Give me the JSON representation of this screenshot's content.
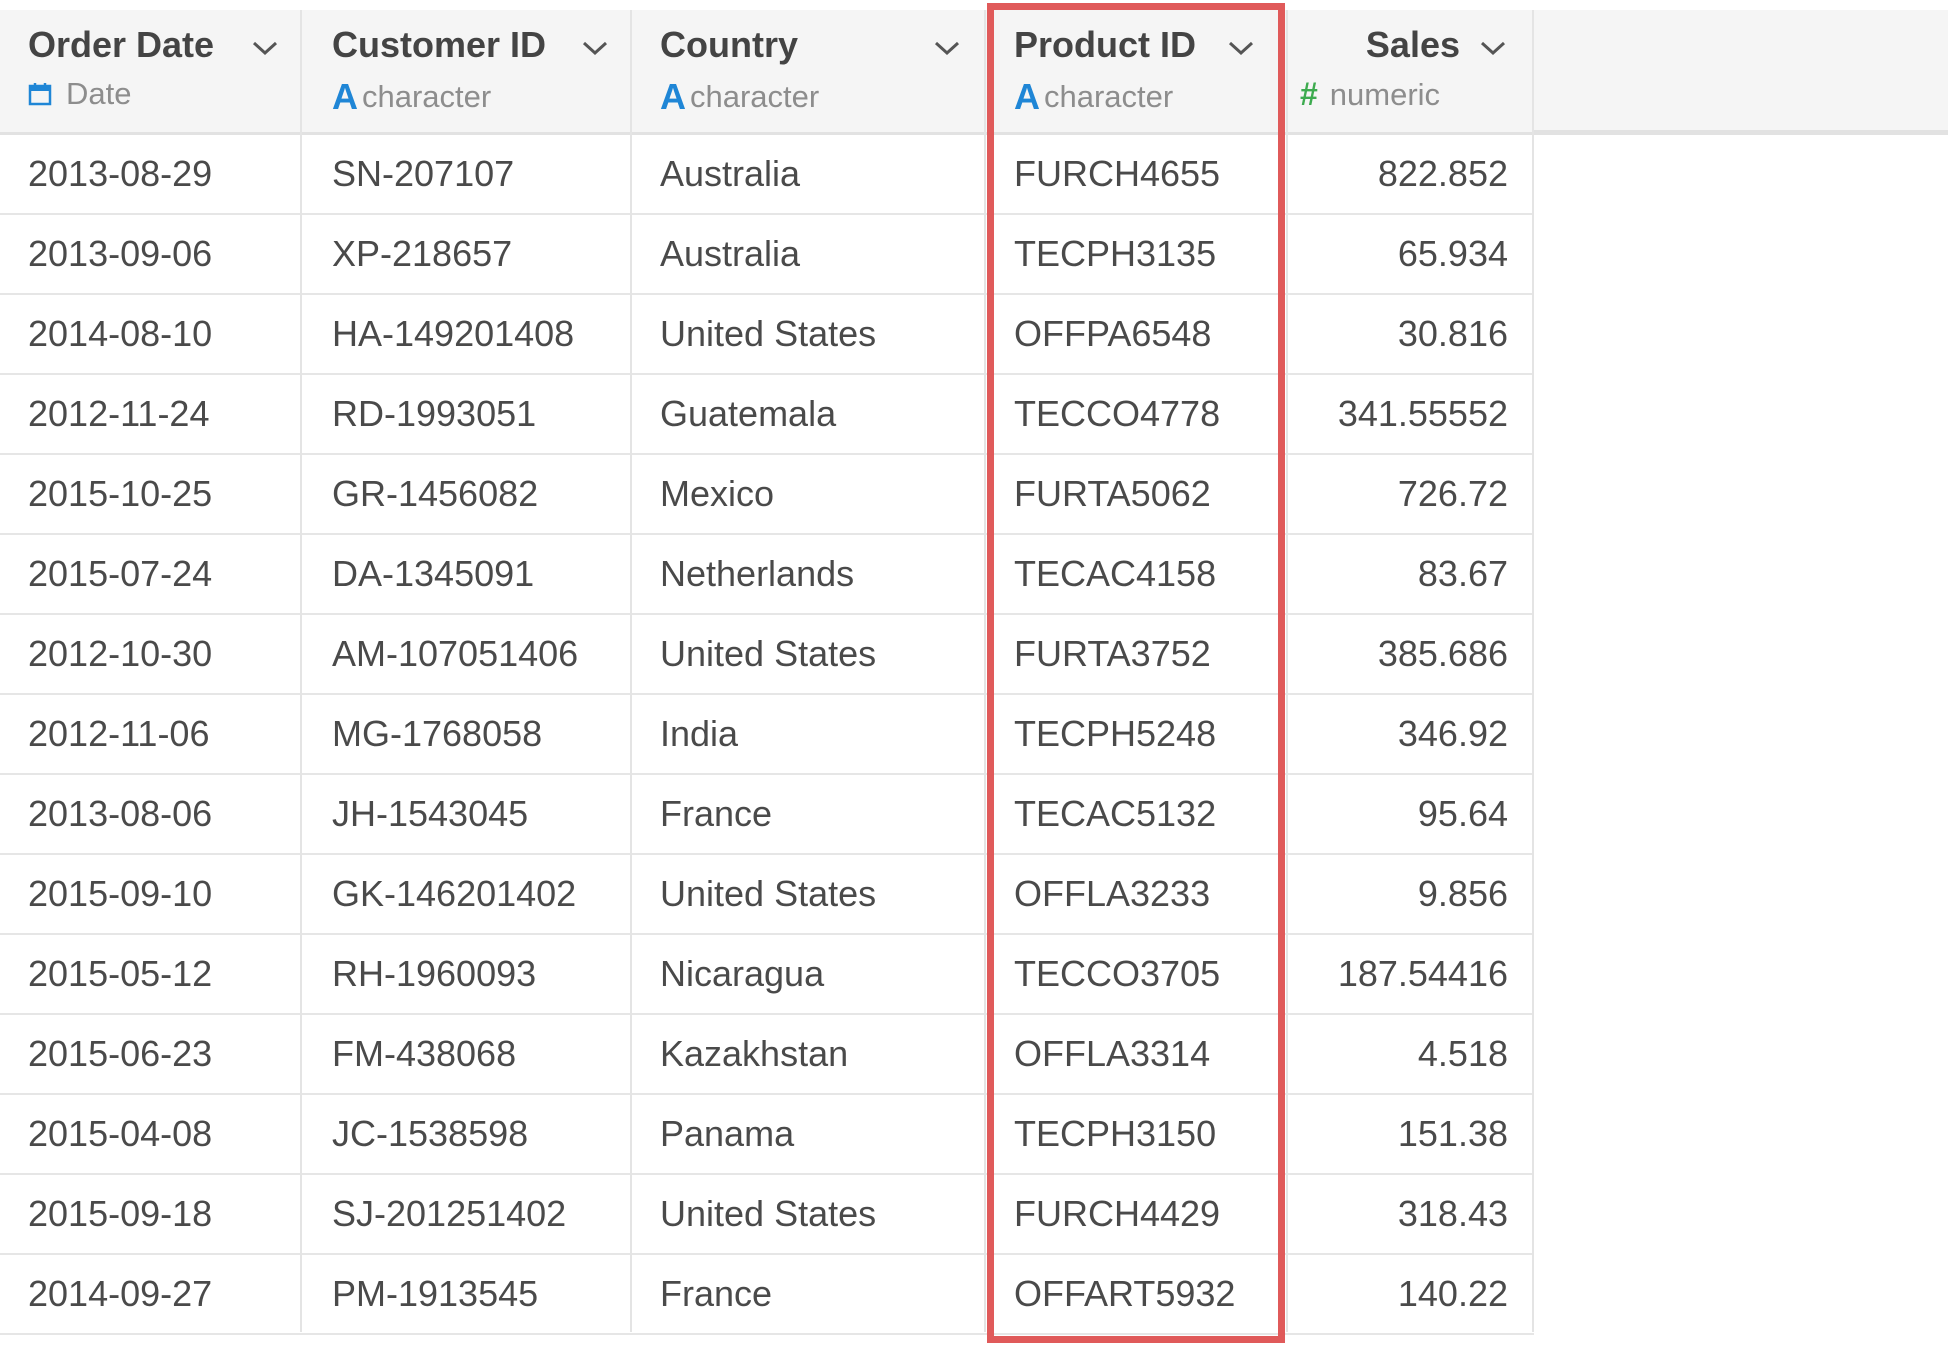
{
  "columns": [
    {
      "name": "Order Date",
      "type": "Date",
      "type_icon": "calendar-icon",
      "align": "left"
    },
    {
      "name": "Customer ID",
      "type": "character",
      "type_icon": "character-A-icon",
      "align": "left"
    },
    {
      "name": "Country",
      "type": "character",
      "type_icon": "character-A-icon",
      "align": "left"
    },
    {
      "name": "Product ID",
      "type": "character",
      "type_icon": "character-A-icon",
      "align": "left",
      "highlighted": true
    },
    {
      "name": "Sales",
      "type": "numeric",
      "type_icon": "numeric-hash-icon",
      "align": "right"
    }
  ],
  "rows": [
    [
      "2013-08-29",
      "SN-207107",
      "Australia",
      "FURCH4655",
      "822.852"
    ],
    [
      "2013-09-06",
      "XP-218657",
      "Australia",
      "TECPH3135",
      "65.934"
    ],
    [
      "2014-08-10",
      "HA-149201408",
      "United States",
      "OFFPA6548",
      "30.816"
    ],
    [
      "2012-11-24",
      "RD-1993051",
      "Guatemala",
      "TECCO4778",
      "341.55552"
    ],
    [
      "2015-10-25",
      "GR-1456082",
      "Mexico",
      "FURTA5062",
      "726.72"
    ],
    [
      "2015-07-24",
      "DA-1345091",
      "Netherlands",
      "TECAC4158",
      "83.67"
    ],
    [
      "2012-10-30",
      "AM-107051406",
      "United States",
      "FURTA3752",
      "385.686"
    ],
    [
      "2012-11-06",
      "MG-1768058",
      "India",
      "TECPH5248",
      "346.92"
    ],
    [
      "2013-08-06",
      "JH-1543045",
      "France",
      "TECAC5132",
      "95.64"
    ],
    [
      "2015-09-10",
      "GK-146201402",
      "United States",
      "OFFLA3233",
      "9.856"
    ],
    [
      "2015-05-12",
      "RH-1960093",
      "Nicaragua",
      "TECCO3705",
      "187.54416"
    ],
    [
      "2015-06-23",
      "FM-438068",
      "Kazakhstan",
      "OFFLA3314",
      "4.518"
    ],
    [
      "2015-04-08",
      "JC-1538598",
      "Panama",
      "TECPH3150",
      "151.38"
    ],
    [
      "2015-09-18",
      "SJ-201251402",
      "United States",
      "FURCH4429",
      "318.43"
    ],
    [
      "2014-09-27",
      "PM-1913545",
      "France",
      "OFFART5932",
      "140.22"
    ]
  ],
  "colors": {
    "highlight_border": "#e05a5a",
    "character_icon": "#1f86d6",
    "numeric_icon": "#3dab4f",
    "date_icon": "#1f86d6",
    "header_bg": "#f5f5f5"
  }
}
